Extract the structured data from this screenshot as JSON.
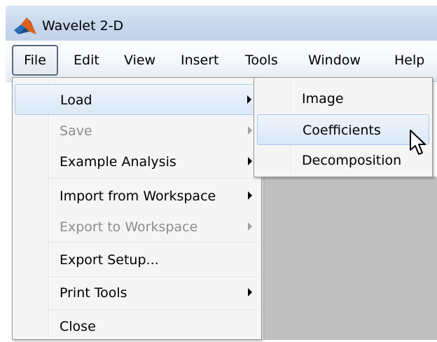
{
  "window": {
    "title": "Wavelet 2-D"
  },
  "menubar": {
    "items": [
      "File",
      "Edit",
      "View",
      "Insert",
      "Tools",
      "Window",
      "Help"
    ]
  },
  "file_menu": {
    "items": [
      {
        "label": "Load",
        "submenu": true,
        "enabled": true,
        "highlighted": true
      },
      {
        "label": "Save",
        "submenu": true,
        "enabled": false
      },
      {
        "label": "Example Analysis",
        "submenu": true,
        "enabled": true
      },
      {
        "label": "Import from Workspace",
        "submenu": true,
        "enabled": true
      },
      {
        "label": "Export to Workspace",
        "submenu": true,
        "enabled": false
      },
      {
        "label": "Export Setup...",
        "submenu": false,
        "enabled": true
      },
      {
        "label": "Print Tools",
        "submenu": true,
        "enabled": true
      },
      {
        "label": "Close",
        "submenu": false,
        "enabled": true
      }
    ]
  },
  "load_submenu": {
    "items": [
      {
        "label": "Image",
        "highlighted": false
      },
      {
        "label": "Coefficients",
        "highlighted": true
      },
      {
        "label": "Decomposition",
        "highlighted": false
      }
    ]
  },
  "icons": {
    "app": "matlab-logo-icon",
    "cursor": "mouse-pointer-icon"
  }
}
